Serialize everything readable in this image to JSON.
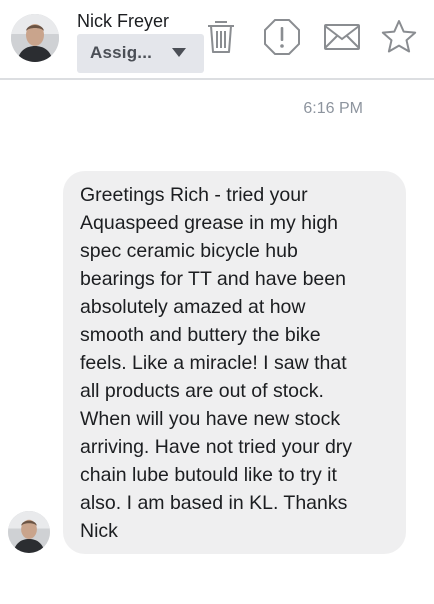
{
  "header": {
    "contact_name": "Nick Freyer",
    "assign_label": "Assig...",
    "icons": [
      "trash-icon",
      "alert-icon",
      "mail-icon",
      "star-icon"
    ]
  },
  "conversation": {
    "timestamp": "6:16 PM",
    "message": "Greetings Rich - tried your\nAquaspeed grease in my high\nspec ceramic bicycle hub\nbearings for TT and have been\nabsolutely amazed at how\nsmooth and buttery the bike\nfeels.  Like a miracle!  I saw that\nall products are out of stock.\nWhen will you have new stock\narriving.  Have not tried your dry\nchain lube butould like to try it\nalso.  I am based in KL.  Thanks\nNick"
  },
  "colors": {
    "bubble": "#efeff0",
    "icon_stroke": "#8a8d91",
    "dropdown_bg": "#e4e6eb",
    "timestamp": "#8d949e"
  }
}
